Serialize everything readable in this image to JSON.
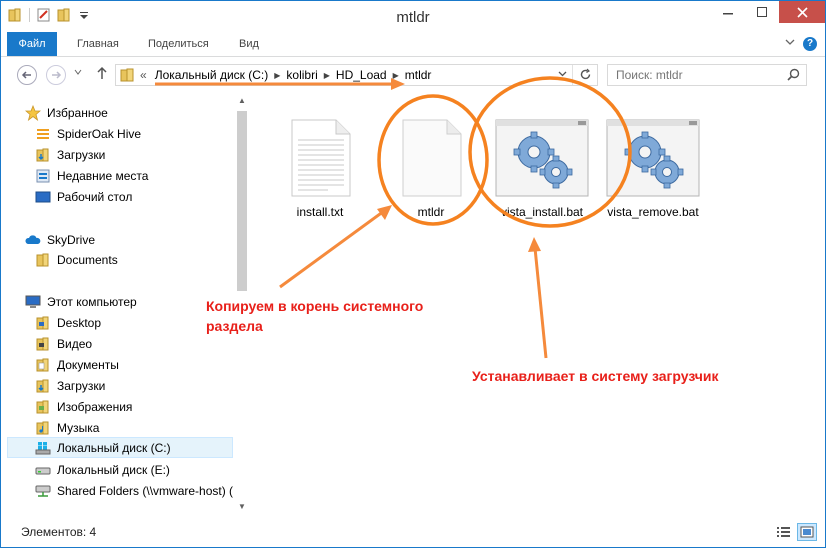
{
  "window": {
    "title": "mtldr",
    "controls": [
      "minimize-icon",
      "maximize-icon",
      "close-icon"
    ]
  },
  "ribbon": {
    "tabs": [
      "Файл",
      "Главная",
      "Поделиться",
      "Вид"
    ]
  },
  "address_bar": {
    "crumb_prefix": "«",
    "crumbs": [
      "Локальный диск (C:)",
      "kolibri",
      "HD_Load",
      "mtldr"
    ]
  },
  "search": {
    "placeholder": "Поиск: mtldr"
  },
  "nav_pane": {
    "items": [
      {
        "label": "Избранное",
        "icon": "star-icon"
      },
      {
        "label": "SpiderOak Hive",
        "icon": "spideroak-icon"
      },
      {
        "label": "Загрузки",
        "icon": "downloads-folder-icon"
      },
      {
        "label": "Недавние места",
        "icon": "recent-places-icon"
      },
      {
        "label": "Рабочий стол",
        "icon": "desktop-icon"
      },
      {
        "label": "SkyDrive",
        "icon": "cloud-icon"
      },
      {
        "label": "Documents",
        "icon": "folder-icon"
      },
      {
        "label": "Этот компьютер",
        "icon": "computer-icon"
      },
      {
        "label": "Desktop",
        "icon": "folder-icon"
      },
      {
        "label": "Видео",
        "icon": "video-folder-icon"
      },
      {
        "label": "Документы",
        "icon": "documents-folder-icon"
      },
      {
        "label": "Загрузки",
        "icon": "downloads-folder-icon"
      },
      {
        "label": "Изображения",
        "icon": "pictures-folder-icon"
      },
      {
        "label": "Музыка",
        "icon": "music-folder-icon"
      },
      {
        "label": "Локальный диск (C:)",
        "icon": "windows-drive-icon"
      },
      {
        "label": "Локальный диск (E:)",
        "icon": "drive-icon"
      },
      {
        "label": "Shared Folders (\\\\vmware-host) (",
        "icon": "network-drive-icon"
      }
    ],
    "selected_label": "Локальный диск (C:)"
  },
  "files": [
    {
      "name": "install.txt",
      "icon": "text-file-icon"
    },
    {
      "name": "mtldr",
      "icon": "blank-file-icon"
    },
    {
      "name": "vista_install.bat",
      "icon": "batch-gears-icon"
    },
    {
      "name": "vista_remove.bat",
      "icon": "batch-gears-icon"
    }
  ],
  "status_bar": {
    "item_count": "Элементов: 4"
  },
  "annotations": {
    "copy_note": "Копируем в корень системного\nраздела",
    "install_note": "Устанавливает в систему загрузчик",
    "color": "#e8201a",
    "arrow_color": "#f58a3c",
    "circle_color": "#f58220"
  },
  "colors": {
    "accent": "#1979ca",
    "close_button": "#c7504a",
    "selection": "#e5f3fb"
  }
}
